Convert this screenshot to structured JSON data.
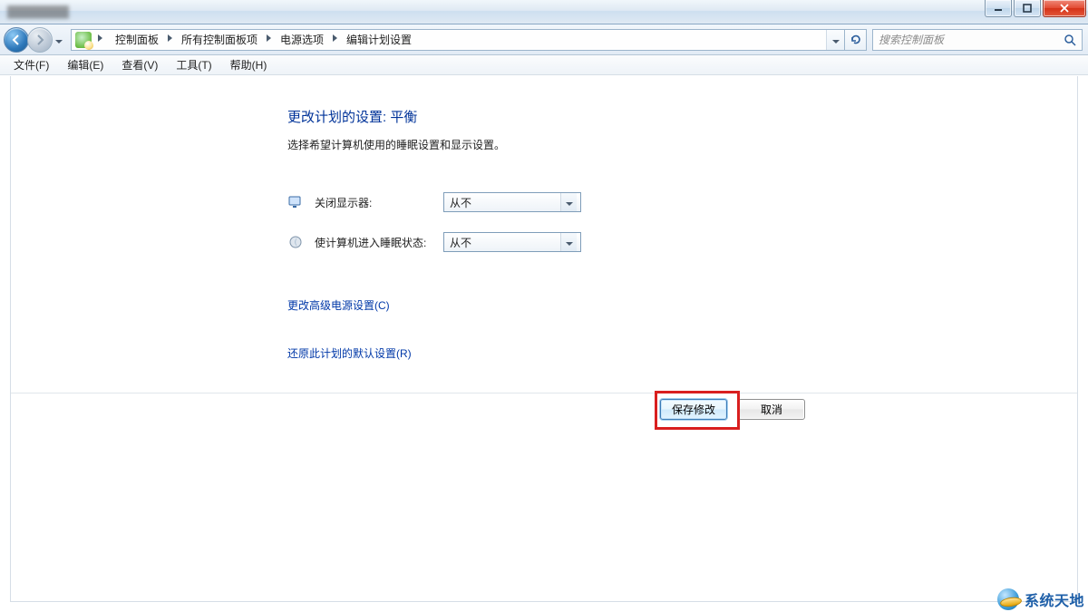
{
  "window": {
    "min_tooltip": "最小化",
    "max_tooltip": "最大化",
    "close_tooltip": "关闭"
  },
  "breadcrumbs": {
    "items": [
      "控制面板",
      "所有控制面板项",
      "电源选项",
      "编辑计划设置"
    ]
  },
  "search": {
    "placeholder": "搜索控制面板"
  },
  "menubar": {
    "items": [
      "文件(F)",
      "编辑(E)",
      "查看(V)",
      "工具(T)",
      "帮助(H)"
    ]
  },
  "page": {
    "title": "更改计划的设置: 平衡",
    "description": "选择希望计算机使用的睡眠设置和显示设置。"
  },
  "settings": {
    "display_off": {
      "label": "关闭显示器:",
      "value": "从不"
    },
    "sleep": {
      "label": "使计算机进入睡眠状态:",
      "value": "从不"
    }
  },
  "links": {
    "advanced": "更改高级电源设置(C)",
    "restore_defaults": "还原此计划的默认设置(R)"
  },
  "buttons": {
    "save": "保存修改",
    "cancel": "取消"
  },
  "watermark": {
    "text": "系统天地"
  }
}
